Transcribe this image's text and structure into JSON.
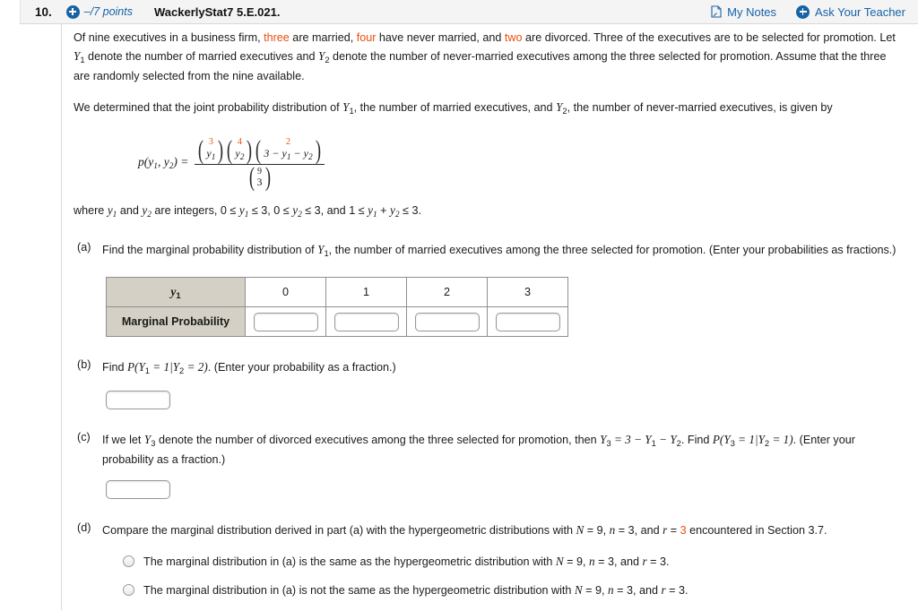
{
  "header": {
    "question_number": "10.",
    "points": "–/7 points",
    "plus_icon": "circle-plus-icon",
    "title": "WackerlyStat7 5.E.021.",
    "my_notes": "My Notes",
    "my_notes_icon": "note-page-icon",
    "ask_teacher": "Ask Your Teacher",
    "ask_teacher_icon": "circle-plus-icon",
    "link_color": "#1763a6"
  },
  "colors": {
    "highlight": "#e8500f",
    "table_header_bg": "#d4d0c5",
    "header_bar_bg": "#f4f4f4"
  },
  "intro": {
    "p1_a": "Of nine executives in a business firm, ",
    "p1_three": "three",
    "p1_b": " are married, ",
    "p1_four": "four",
    "p1_c": " have never married, and ",
    "p1_two": "two",
    "p1_d": " are divorced. Three of the executives are to be selected for promotion. Let ",
    "p1_e": " denote the number of married executives and ",
    "p1_f": " denote the number of never-married executives among the three selected for promotion. Assume that the three are randomly selected from the nine available.",
    "p2_a": "We determined that the joint probability distribution of ",
    "p2_b": ", the number of married executives, and ",
    "p2_c": ", the number of never-married executives, is given by",
    "where_a": "where ",
    "where_b": " and ",
    "where_c": " are integers, 0 ≤ ",
    "where_d": " ≤ 3, 0 ≤ ",
    "where_e": " ≤ 3, and 1 ≤ ",
    "where_f": " + ",
    "where_g": " ≤ 3."
  },
  "formula": {
    "lhs_p": "p",
    "lhs_open": "(",
    "lhs_y1": "y",
    "lhs_y1sub": "1",
    "lhs_comma": ", ",
    "lhs_y2": "y",
    "lhs_y2sub": "2",
    "lhs_close": ") =",
    "num_b1_top": "3",
    "num_b1_bot": "y",
    "num_b1_botsub": "1",
    "num_b2_top": "4",
    "num_b2_bot": "y",
    "num_b2_botsub": "2",
    "num_b3_top": "2",
    "num_b3_bot": "3 − y",
    "num_b3_botsub1": "1",
    "num_b3_botmid": " − y",
    "num_b3_botsub2": "2",
    "den_top": "9",
    "den_bot": "3"
  },
  "parts": {
    "a": {
      "label": "(a)",
      "text_a": "Find the marginal probability distribution of ",
      "var": "Y",
      "var_sub": "1",
      "text_b": ", the number of married executives among the three selected for promotion. (Enter your probabilities as fractions.)"
    },
    "b": {
      "label": "(b)",
      "text_a": "Find ",
      "text_expr": "P(Y₁ = 1|Y₂ = 2)",
      "text_b": ". (Enter your probability as a fraction.)",
      "answer_value": ""
    },
    "c": {
      "label": "(c)",
      "text_a": "If we let ",
      "text_b": " denote the number of divorced executives among the three selected for promotion, then ",
      "text_c": ". Find ",
      "text_d": ". (Enter your probability as a fraction.)",
      "answer_value": ""
    },
    "d": {
      "label": "(d)",
      "text_a": "Compare the marginal distribution derived in part (a) with the hypergeometric distributions with ",
      "text_N": "N",
      "text_b": " = 9, ",
      "text_n": "n",
      "text_c": " = 3, and ",
      "text_r": "r",
      "text_d": " = ",
      "text_r_val": "3",
      "text_e": " encountered in Section 3.7.",
      "options": [
        {
          "text_a": "The marginal distribution in (a) is the same as the hypergeometric distribution with ",
          "text_b": " = 9, ",
          "text_c": " = 3, and ",
          "text_d": " = 3.",
          "selected": false
        },
        {
          "text_a": "The marginal distribution in (a) is not the same as the hypergeometric distribution with ",
          "text_b": " = 9, ",
          "text_c": " = 3, and ",
          "text_d": " = 3.",
          "selected": false
        }
      ]
    }
  },
  "table": {
    "row_header_1": "y",
    "row_header_1_sub": "1",
    "row_header_2": "Marginal Probability",
    "columns": [
      "0",
      "1",
      "2",
      "3"
    ],
    "input_values": [
      "",
      "",
      "",
      ""
    ]
  }
}
